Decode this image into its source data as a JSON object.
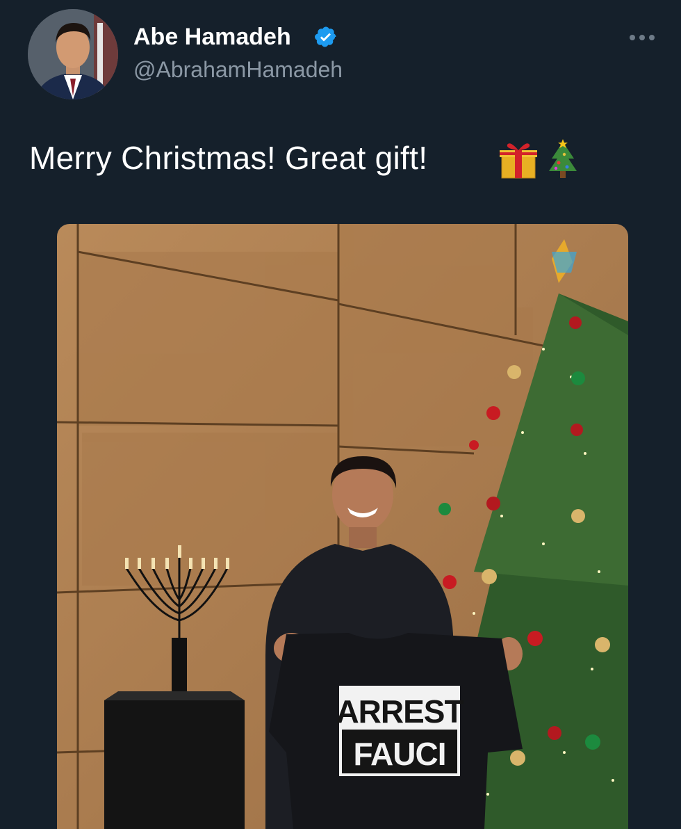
{
  "author": {
    "name": "Abe Hamadeh",
    "handle": "@AbrahamHamadeh",
    "verified": true
  },
  "tweet": {
    "text": "Merry Christmas! Great gift!",
    "emojis": [
      "wrapped-gift-icon",
      "christmas-tree-icon"
    ]
  },
  "photo": {
    "shirt_text": {
      "line1": "ARREST",
      "line2": "FAUCI"
    }
  },
  "colors": {
    "background": "#15202b",
    "secondary_text": "#8b98a5",
    "verified_blue": "#1d9bf0"
  }
}
